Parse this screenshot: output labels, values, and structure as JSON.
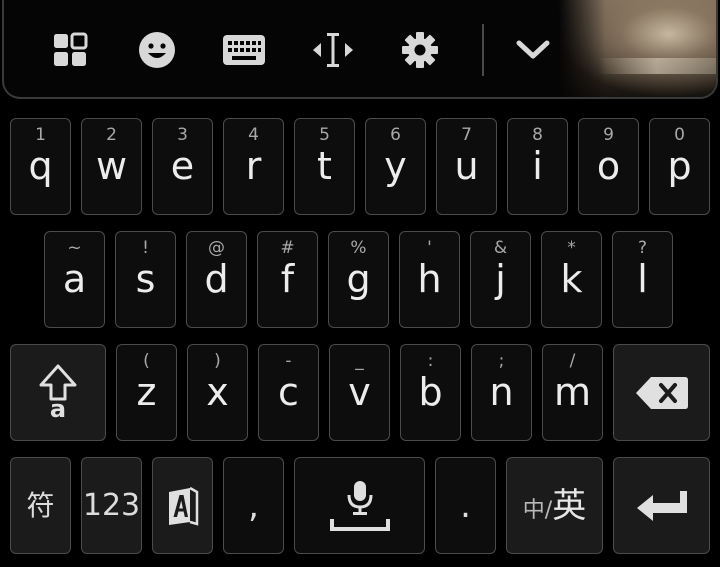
{
  "toolbar": {
    "icons": [
      "layout-grid-icon",
      "emoji-icon",
      "keyboard-icon",
      "text-cursor-icon",
      "settings-gear-icon",
      "chevron-down-icon"
    ],
    "icon_color": "#d8d8d8"
  },
  "rows": {
    "row1": [
      {
        "hint": "1",
        "char": "q"
      },
      {
        "hint": "2",
        "char": "w"
      },
      {
        "hint": "3",
        "char": "e"
      },
      {
        "hint": "4",
        "char": "r"
      },
      {
        "hint": "5",
        "char": "t"
      },
      {
        "hint": "6",
        "char": "y"
      },
      {
        "hint": "7",
        "char": "u"
      },
      {
        "hint": "8",
        "char": "i"
      },
      {
        "hint": "9",
        "char": "o"
      },
      {
        "hint": "0",
        "char": "p"
      }
    ],
    "row2": [
      {
        "hint": "~",
        "char": "a"
      },
      {
        "hint": "!",
        "char": "s"
      },
      {
        "hint": "@",
        "char": "d"
      },
      {
        "hint": "#",
        "char": "f"
      },
      {
        "hint": "%",
        "char": "g"
      },
      {
        "hint": "'",
        "char": "h"
      },
      {
        "hint": "&",
        "char": "j"
      },
      {
        "hint": "*",
        "char": "k"
      },
      {
        "hint": "?",
        "char": "l"
      }
    ],
    "row3": [
      {
        "hint": "(",
        "char": "z"
      },
      {
        "hint": ")",
        "char": "x"
      },
      {
        "hint": "-",
        "char": "c"
      },
      {
        "hint": "_",
        "char": "v"
      },
      {
        "hint": ":",
        "char": "b"
      },
      {
        "hint": ";",
        "char": "n"
      },
      {
        "hint": "/",
        "char": "m"
      }
    ]
  },
  "special": {
    "shift_sub": "a",
    "symbols_label": "符",
    "numbers_label": "123",
    "comma_label": ",",
    "period_label": ".",
    "lang_small": "中/",
    "lang_big": "英"
  },
  "colors": {
    "background": "#000000",
    "key_border": "#4b4b4b",
    "key_fill": "#0d0d0d",
    "key_text": "#ececec",
    "hint_text": "#a8a8a8"
  }
}
